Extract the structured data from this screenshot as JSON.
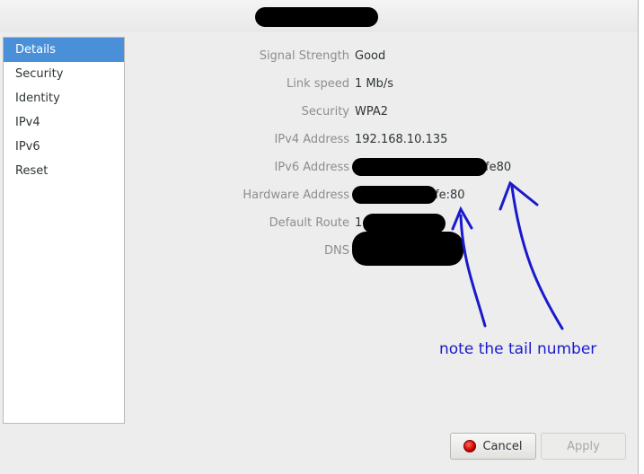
{
  "sidebar": {
    "items": [
      {
        "label": "Details"
      },
      {
        "label": "Security"
      },
      {
        "label": "Identity"
      },
      {
        "label": "IPv4"
      },
      {
        "label": "IPv6"
      },
      {
        "label": "Reset"
      }
    ],
    "active_index": 0
  },
  "details": {
    "signal_strength": {
      "label": "Signal Strength",
      "value": "Good"
    },
    "link_speed": {
      "label": "Link speed",
      "value": "1 Mb/s"
    },
    "security": {
      "label": "Security",
      "value": "WPA2"
    },
    "ipv4": {
      "label": "IPv4 Address",
      "value": "192.168.10.135"
    },
    "ipv6": {
      "label": "IPv6 Address",
      "value": "fe80"
    },
    "hardware": {
      "label": "Hardware Address",
      "value": "fe:80"
    },
    "default_route": {
      "label": "Default Route",
      "value": "1"
    },
    "dns": {
      "label": "DNS",
      "value": ""
    }
  },
  "buttons": {
    "cancel_label": "Cancel",
    "apply_label": "Apply"
  },
  "annotation": {
    "text": "note the tail number",
    "color": "#1a1acc"
  },
  "colors": {
    "accent": "#4a90d9",
    "cancel_icon": "#cc0000"
  },
  "icons": {
    "cancel": "stop-icon"
  }
}
